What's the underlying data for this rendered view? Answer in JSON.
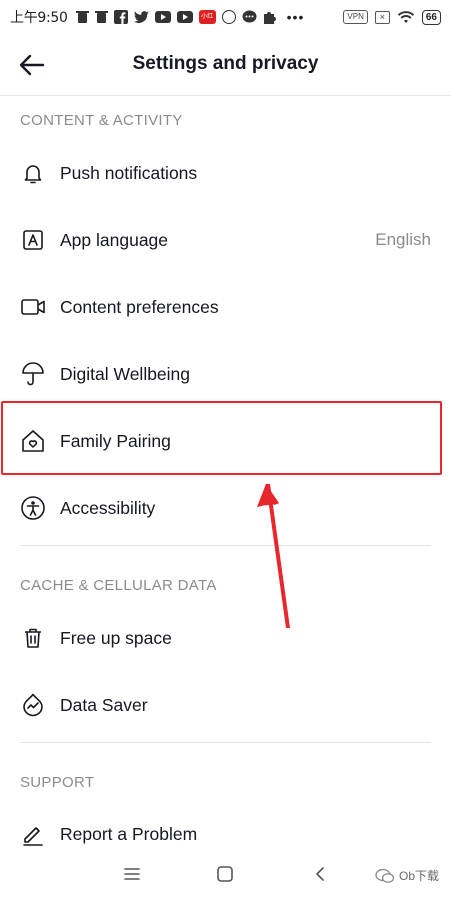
{
  "status_bar": {
    "time": "上午9:50",
    "vpn_label": "VPN",
    "battery": "66",
    "red_badge": "小红书"
  },
  "header": {
    "title": "Settings and privacy",
    "back_icon": "arrow-left-icon"
  },
  "sections": [
    {
      "title": "CONTENT & ACTIVITY",
      "items": [
        {
          "label": "Push notifications",
          "icon": "bell-icon"
        },
        {
          "label": "App language",
          "icon": "language-icon",
          "value": "English"
        },
        {
          "label": "Content preferences",
          "icon": "video-camera-icon"
        },
        {
          "label": "Digital Wellbeing",
          "icon": "umbrella-icon"
        },
        {
          "label": "Family Pairing",
          "icon": "house-heart-icon",
          "highlighted": true
        },
        {
          "label": "Accessibility",
          "icon": "accessibility-icon"
        }
      ]
    },
    {
      "title": "CACHE & CELLULAR DATA",
      "items": [
        {
          "label": "Free up space",
          "icon": "trash-icon"
        },
        {
          "label": "Data Saver",
          "icon": "data-saver-icon"
        }
      ]
    },
    {
      "title": "SUPPORT",
      "items": [
        {
          "label": "Report a Problem",
          "icon": "pencil-icon"
        }
      ]
    }
  ],
  "annotation": {
    "color": "#e8262b"
  },
  "nav_bar": {
    "items": [
      "menu-icon",
      "home-square-icon",
      "back-chevron-icon"
    ]
  },
  "watermark": {
    "text": "Ob下载"
  }
}
